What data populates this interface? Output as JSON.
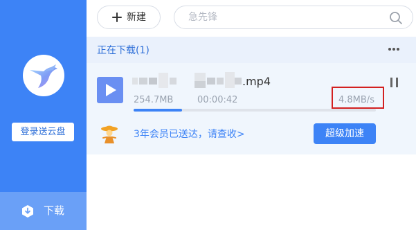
{
  "sidebar": {
    "login_label": "登录送云盘",
    "nav_download_label": "下载"
  },
  "toolbar": {
    "new_label": "新建",
    "search_placeholder": "急先锋"
  },
  "section": {
    "title": "正在下载(1)"
  },
  "download": {
    "filename_ext": ".mp4",
    "size": "254.7MB",
    "elapsed": "00:00:42",
    "speed": "4.8MB/s",
    "progress": 0.2
  },
  "promo": {
    "text": "3年会员已送达，请查收>",
    "boost_label": "超级加速"
  },
  "colors": {
    "accent": "#3d83f6",
    "highlight_box": "#d32020"
  }
}
